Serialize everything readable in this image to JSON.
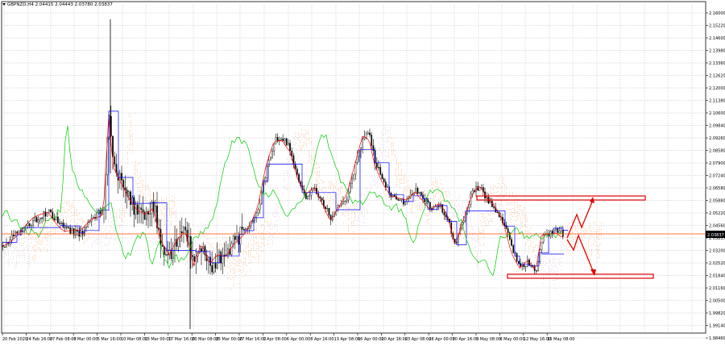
{
  "header": {
    "symbol_info": "GBPNZD,H4  2.04415 2.04443 2.03780 2.03837"
  },
  "price_axis": {
    "labels": [
      "2.16000",
      "2.15220",
      "2.14600",
      "2.13980",
      "2.13360",
      "2.12620",
      "2.12000",
      "2.11380",
      "2.10600",
      "2.09840",
      "2.09260",
      "2.08580",
      "2.07900",
      "2.07240",
      "2.06580",
      "2.05880",
      "2.05220",
      "2.04560",
      "2.03837",
      "2.03200",
      "2.02520",
      "2.01840",
      "2.01160",
      "2.00500",
      "1.99820",
      "1.99140",
      "1.98460"
    ],
    "current_price": "2.03837"
  },
  "time_axis": {
    "labels": [
      "20 Feb 2020",
      "24 Feb 16:00",
      "27 Feb 08:00",
      "3 Mar 00:00",
      "5 Mar 16:00",
      "10 Mar 08:00",
      "13 Mar 00:00",
      "17 Mar 16:00",
      "20 Mar 08:00",
      "25 Mar 00:00",
      "27 Mar 16:00",
      "1 Apr 08:00",
      "6 Apr 00:00",
      "8 Apr 16:00",
      "13 Apr 08:00",
      "16 Apr 00:00",
      "20 Apr 16:00",
      "23 Apr 08:00",
      "28 Apr 00:00",
      "30 Apr 16:00",
      "5 May 08:00",
      "8 May 00:00",
      "12 May 16:00",
      "15 May 08:00"
    ]
  },
  "colors": {
    "background": "#ffffff",
    "grid": "#c8c8c8",
    "tenkan": "#ff0000",
    "kijun": "#0000ff",
    "chikou": "#00dd00",
    "kumo_bull": "#f4a460",
    "kumo_bear": "#d8bfd8",
    "current_price_line": "#ff4500",
    "annotation": "#e00000",
    "candle": "#000000"
  }
}
